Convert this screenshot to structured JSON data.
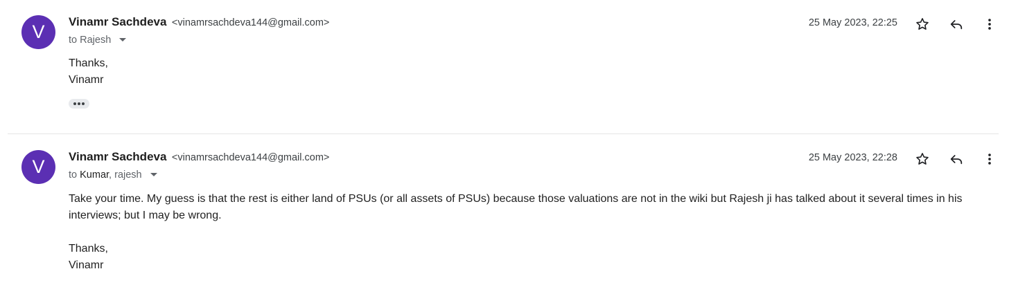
{
  "messages": [
    {
      "avatar_letter": "V",
      "sender_name": "Vinamr Sachdeva",
      "sender_email": "<vinamrsachdeva144@gmail.com>",
      "to_prefix": "to",
      "recipients": "Rajesh",
      "date": "25 May 2023, 22:25",
      "body": {
        "line1": "Thanks,",
        "line2": "Vinamr"
      },
      "avatar_color": "#5b2fb3"
    },
    {
      "avatar_letter": "V",
      "sender_name": "Vinamr Sachdeva",
      "sender_email": "<vinamrsachdeva144@gmail.com>",
      "to_prefix": "to",
      "recipient_primary": "Kumar",
      "recipient_sep": ", ",
      "recipient_secondary": "rajesh",
      "date": "25 May 2023, 22:28",
      "body": {
        "paragraph": "Take your time. My guess is that the rest is either land of PSUs (or all assets of PSUs) because those valuations are not in the wiki but Rajesh ji has talked about it several times in his interviews; but I may be wrong.",
        "line1": "Thanks,",
        "line2": "Vinamr"
      },
      "avatar_color": "#5b2fb3"
    }
  ],
  "icons": {
    "star": "star-icon",
    "reply": "reply-icon",
    "more": "more-vert-icon",
    "dropdown": "chevron-down-icon",
    "trimmed": "ellipsis-icon"
  }
}
